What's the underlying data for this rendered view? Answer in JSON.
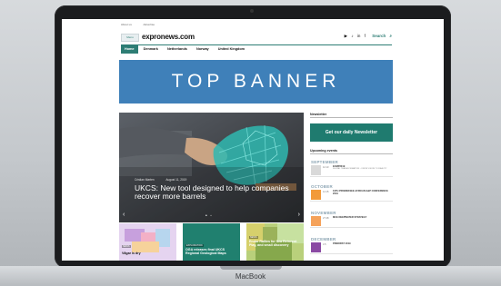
{
  "device_label": "MacBook",
  "site": {
    "top_links": [
      "About us",
      "Advertise"
    ],
    "menu_label": "Menu",
    "logo": "expronews.com",
    "social_icons": [
      "youtube-icon",
      "twitter-icon",
      "linkedin-icon",
      "facebook-icon"
    ],
    "search_label": "Search",
    "nav": [
      "Home",
      "Denmark",
      "Netherlands",
      "Norway",
      "United Kingdom"
    ],
    "banner": "TOP BANNER",
    "hero": {
      "author": "Cristian Marten",
      "date": "August 11, 2019",
      "title": "UKCS: New tool designed to help companies recover more barrels"
    },
    "cards": [
      {
        "tag": "NEWS",
        "title": "Vågar is dry"
      },
      {
        "tag": "EXPLORATION",
        "title": "OGA releases final UKCS Regional Geological Maps"
      },
      {
        "tag": "NEWS",
        "title": "Endur Rallies for Sea Reinvent Play, and small discovery"
      }
    ],
    "sidebar": {
      "newsletter_heading": "Newsletter",
      "newsletter_button": "Get our daily Newsletter",
      "events_heading": "Upcoming events",
      "months": [
        "SEPTEMBER",
        "OCTOBER",
        "NOVEMBER",
        "DECEMBER"
      ],
      "events": [
        {
          "date": "12\n13",
          "title": "ECMP2019",
          "sub": "DIGITAL TRANSFORMATION – FROM VISION TO REALITY"
        },
        {
          "date": "14\n15",
          "title": "19TH PROMEKSEE AFRICAN E&P CONFERENCE 2019",
          "sub": ""
        },
        {
          "date": "27\n28",
          "title": "MCE DEEPWATER STRATEGY",
          "sub": ""
        },
        {
          "date": "4\n5",
          "title": "PREDIRST 2019",
          "sub": ""
        }
      ]
    },
    "colors": {
      "accent": "#2d7d74",
      "banner": "#3f80b9",
      "newsletter": "#1f7b6f"
    }
  }
}
